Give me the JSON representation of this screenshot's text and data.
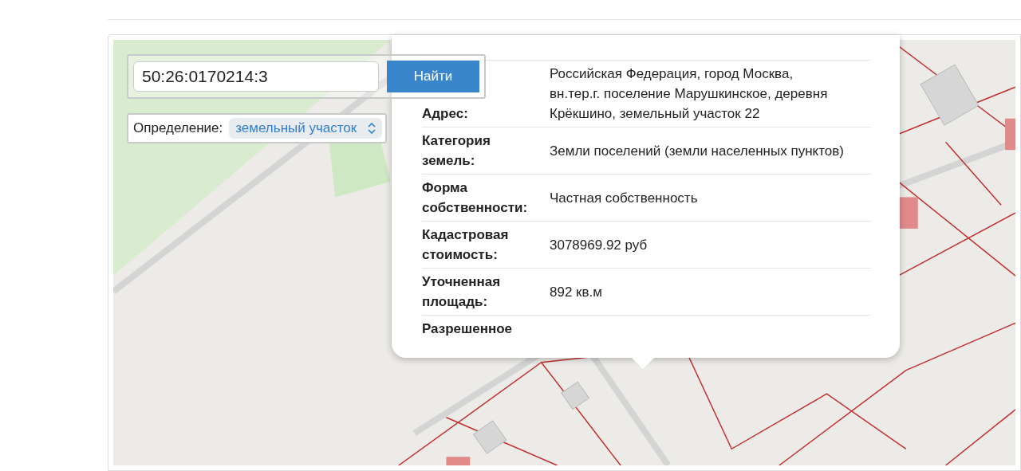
{
  "search": {
    "value": "50:26:0170214:3",
    "button": "Найти"
  },
  "definition": {
    "label": "Определение:",
    "value": "земельный участок"
  },
  "popup": {
    "rows": [
      {
        "label": "Адрес:",
        "value": "Российская Федерация, город Москва, вн.тер.г. поселение Марушкинское, деревня Крёкшино, земельный участок 22"
      },
      {
        "label": "Категория земель:",
        "value": "Земли поселений (земли населенных пунктов)"
      },
      {
        "label": "Форма собственности:",
        "value": "Частная собственность"
      },
      {
        "label": "Кадастровая стоимость:",
        "value": "3078969.92 руб"
      },
      {
        "label": "Уточненная площадь:",
        "value": "892 кв.м"
      },
      {
        "label": "Разрешенное"
      }
    ]
  }
}
